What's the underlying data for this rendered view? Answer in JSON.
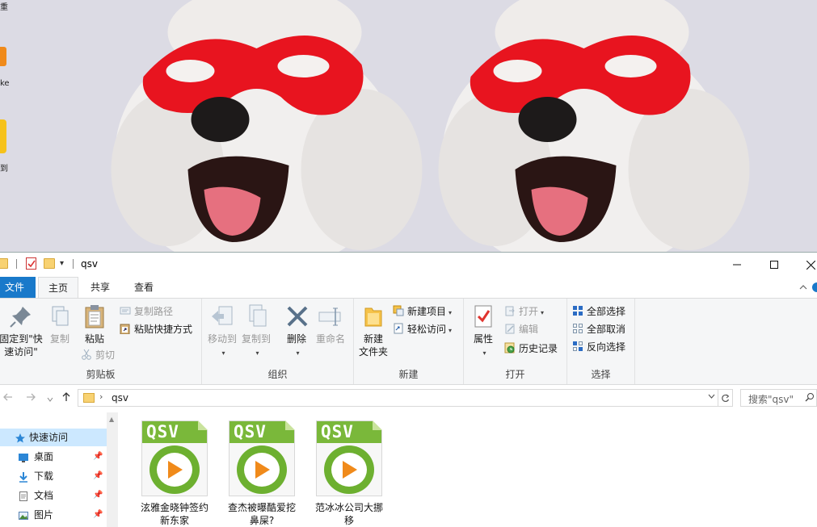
{
  "window": {
    "title": "qsv",
    "dropdown_glyph": "▾",
    "minimize": "minimize-icon",
    "maximize": "maximize-icon",
    "close": "close-icon"
  },
  "desktop": {
    "label_top": "重",
    "label_mid": "ke",
    "label_bottom": "到"
  },
  "tabs": [
    {
      "label": "文件"
    },
    {
      "label": "主页"
    },
    {
      "label": "共享"
    },
    {
      "label": "查看"
    }
  ],
  "ribbon": {
    "clipboard": {
      "label": "剪贴板",
      "pin_quick_line1": "固定到\"快",
      "pin_quick_line2": "速访问\"",
      "copy": "复制",
      "paste": "粘贴",
      "copy_path": "复制路径",
      "paste_shortcut": "粘贴快捷方式",
      "cut": "剪切"
    },
    "organize": {
      "label": "组织",
      "move_to": "移动到",
      "copy_to": "复制到",
      "delete": "删除",
      "rename": "重命名"
    },
    "new": {
      "label": "新建",
      "new_folder_line1": "新建",
      "new_folder_line2": "文件夹",
      "new_item": "新建项目",
      "easy_access": "轻松访问"
    },
    "open": {
      "label": "打开",
      "properties": "属性",
      "open": "打开",
      "edit": "编辑",
      "history": "历史记录"
    },
    "select": {
      "label": "选择",
      "select_all": "全部选择",
      "select_none": "全部取消",
      "invert": "反向选择"
    }
  },
  "address": {
    "path": "qsv",
    "search_placeholder": "搜索\"qsv\""
  },
  "navpane": {
    "items": [
      {
        "label": "快速访问",
        "icon": "star-icon"
      },
      {
        "label": "桌面",
        "icon": "desktop-icon"
      },
      {
        "label": "下载",
        "icon": "download-icon"
      },
      {
        "label": "文档",
        "icon": "document-icon"
      },
      {
        "label": "图片",
        "icon": "pictures-icon"
      }
    ]
  },
  "files": [
    {
      "name_line1": "泫雅金晓钟签约",
      "name_line2": "新东家",
      "icon": "qsv-file-icon",
      "badge": "QSV"
    },
    {
      "name_line1": "查杰被曝酷爱挖",
      "name_line2": "鼻屎?",
      "icon": "qsv-file-icon",
      "badge": "QSV"
    },
    {
      "name_line1": "范冰冰公司大挪",
      "name_line2": "移",
      "icon": "qsv-file-icon",
      "badge": "QSV"
    }
  ],
  "colors": {
    "accent": "#1979ca",
    "qsv_green": "#7ab83a",
    "play_orange": "#f08a1a",
    "selected_nav": "#cce8ff"
  }
}
